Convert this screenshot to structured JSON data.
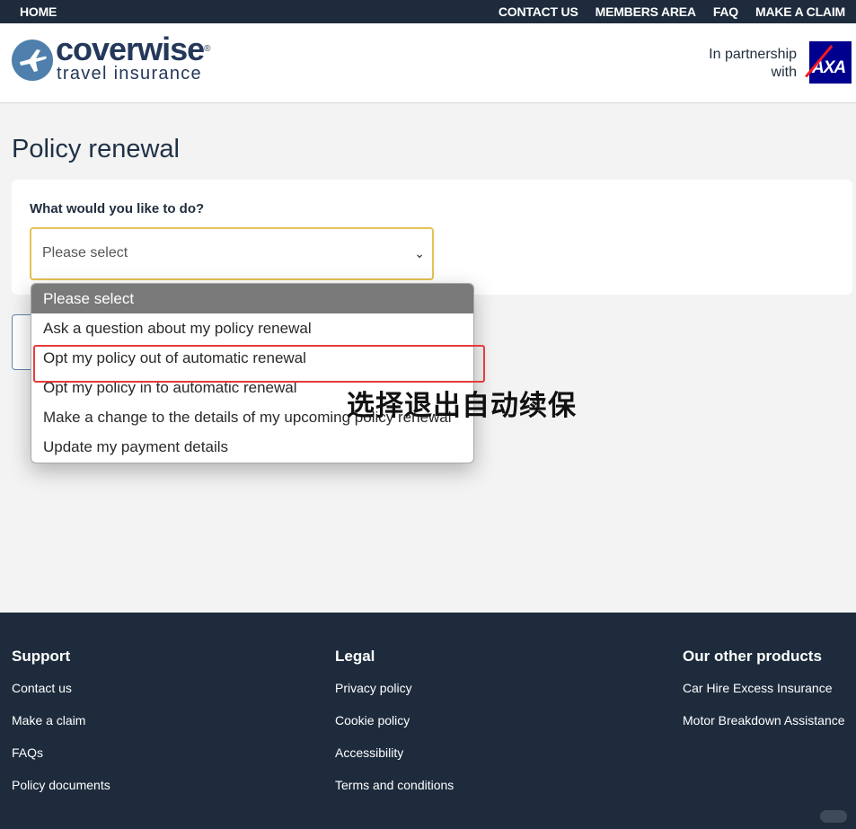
{
  "topnav": {
    "home": "HOME",
    "links": [
      "CONTACT US",
      "MEMBERS AREA",
      "FAQ",
      "MAKE A CLAIM"
    ]
  },
  "header": {
    "brand_name": "coverwise",
    "brand_reg": "®",
    "brand_tagline": "travel insurance",
    "partner_line1": "In partnership",
    "partner_line2": "with",
    "partner_logo_text": "AXA"
  },
  "main": {
    "title": "Policy renewal",
    "question": "What would you like to do?",
    "select_value": "Please select",
    "options": [
      "Please select",
      "Ask a question about my policy renewal",
      "Opt my policy out of automatic renewal",
      "Opt my policy in to automatic renewal",
      "Make a change to the details of my upcoming policy renewal",
      "Update my payment details"
    ],
    "annotation": "选择退出自动续保"
  },
  "footer": {
    "support": {
      "title": "Support",
      "links": [
        "Contact us",
        "Make a claim",
        "FAQs",
        "Policy documents"
      ]
    },
    "legal": {
      "title": "Legal",
      "links": [
        "Privacy policy",
        "Cookie policy",
        "Accessibility",
        "Terms and conditions"
      ]
    },
    "products": {
      "title": "Our other products",
      "links": [
        "Car Hire Excess Insurance",
        "Motor Breakdown Assistance"
      ]
    }
  },
  "colors": {
    "nav_bg": "#1d2b3c",
    "accent_select_border": "#e5c255",
    "highlight_red": "#e53b3b",
    "axa_blue": "#00008f"
  }
}
